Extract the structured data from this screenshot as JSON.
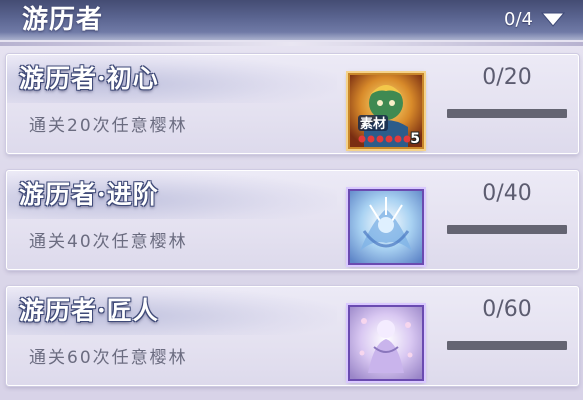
{
  "header": {
    "title": "游历者",
    "progress": "0/4",
    "dropdown_icon": "triangle-down-icon"
  },
  "tasks": [
    {
      "title": "游历者·初心",
      "description": "通关20次任意樱林",
      "reward": {
        "icon": "material-item-icon",
        "badge_text": "素材",
        "count": "5",
        "frame_color": "#c9872a"
      },
      "progress_text": "0/20",
      "progress_fraction": 0
    },
    {
      "title": "游历者·进阶",
      "description": "通关40次任意樱林",
      "reward": {
        "icon": "ice-spirit-icon",
        "frame_color": "#6a4bb0"
      },
      "progress_text": "0/40",
      "progress_fraction": 0
    },
    {
      "title": "游历者·匠人",
      "description": "通关60次任意樱林",
      "reward": {
        "icon": "sakura-spirit-icon",
        "frame_color": "#6a4bb0"
      },
      "progress_text": "0/60",
      "progress_fraction": 0
    }
  ]
}
